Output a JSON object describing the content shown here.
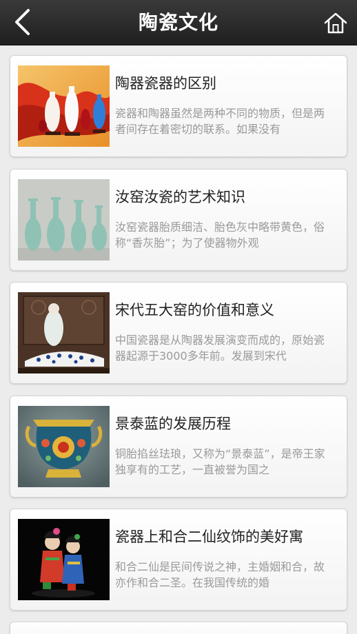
{
  "header": {
    "title": "陶瓷文化",
    "back_icon": "chevron-left-icon",
    "home_icon": "home-icon"
  },
  "articles": [
    {
      "title": "陶器瓷器的区别",
      "desc": "瓷器和陶器虽然是两种不同的物质，但是两者间存在着密切的联系。如果没有",
      "image": "vases-on-red-silk"
    },
    {
      "title": "汝窑汝瓷的艺术知识",
      "desc": "汝窑瓷器胎质细洁、胎色灰中略带黄色，俗称“香灰胎”；为了使器物外观",
      "image": "celadon-vases"
    },
    {
      "title": "宋代五大窑的价值和意义",
      "desc": "中国瓷器是从陶器发展演变而成的，原始瓷器起源于3000多年前。发展到宋代",
      "image": "porcelain-figure"
    },
    {
      "title": "景泰蓝的发展历程",
      "desc": "铜胎掐丝珐琅，又称为“景泰蓝”，是帝王家独享有的工艺，一直被誉为国之",
      "image": "cloisonne-censer"
    },
    {
      "title": "瓷器上和合二仙纹饰的美好寓",
      "desc": "和合二仙是民间传说之神，主婚姻和合，故亦作和合二圣。在我国传统的婚",
      "image": "hehe-twins-figurines"
    }
  ],
  "colors": {
    "header_bg": "#2a2a2a",
    "page_bg": "#ececec",
    "title_text": "#222222",
    "desc_text": "#9a9a9a"
  }
}
